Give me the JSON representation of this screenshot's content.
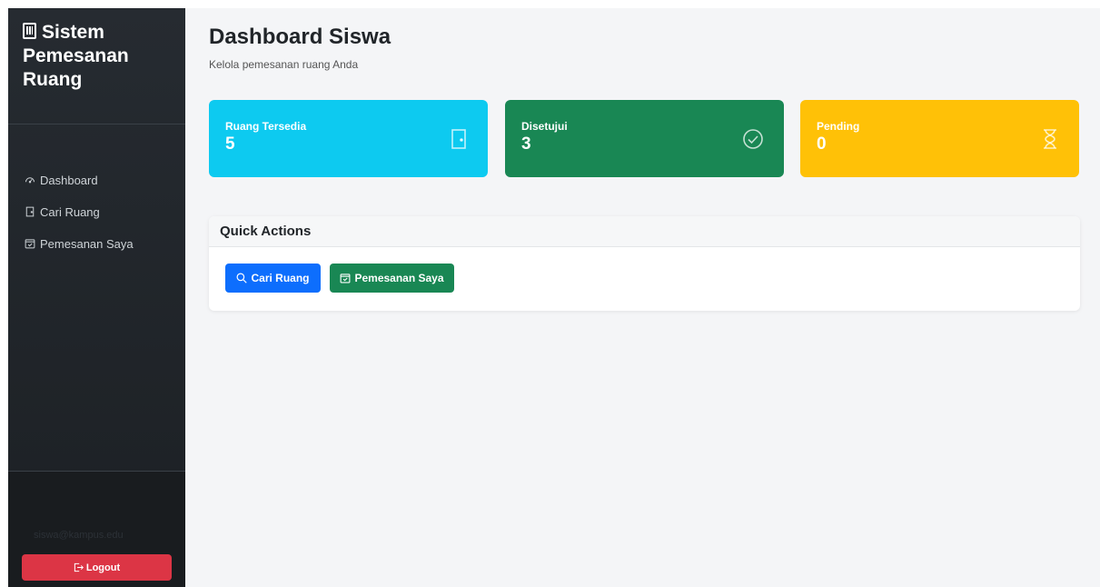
{
  "sidebar": {
    "brand": "Sistem Pemesanan Ruang",
    "nav": [
      {
        "label": "Dashboard",
        "icon": "speedometer-icon"
      },
      {
        "label": "Cari Ruang",
        "icon": "door-icon"
      },
      {
        "label": "Pemesanan Saya",
        "icon": "calendar-check-icon"
      }
    ],
    "user": {
      "email": "siswa@kampus.edu"
    },
    "logout_label": "Logout"
  },
  "main": {
    "title": "Dashboard Siswa",
    "subtitle": "Kelola pemesanan ruang Anda",
    "stats": [
      {
        "label": "Ruang Tersedia",
        "value": "5",
        "color": "#0dcaf0",
        "icon": "door-icon"
      },
      {
        "label": "Disetujui",
        "value": "3",
        "color": "#198754",
        "icon": "check-circle-icon"
      },
      {
        "label": "Pending",
        "value": "0",
        "color": "#ffc107",
        "icon": "hourglass-icon"
      }
    ],
    "quick_actions": {
      "title": "Quick Actions",
      "buttons": [
        {
          "label": "Cari Ruang",
          "color": "#0d6efd",
          "icon": "search-icon"
        },
        {
          "label": "Pemesanan Saya",
          "color": "#198754",
          "icon": "calendar-check-icon"
        }
      ]
    }
  }
}
